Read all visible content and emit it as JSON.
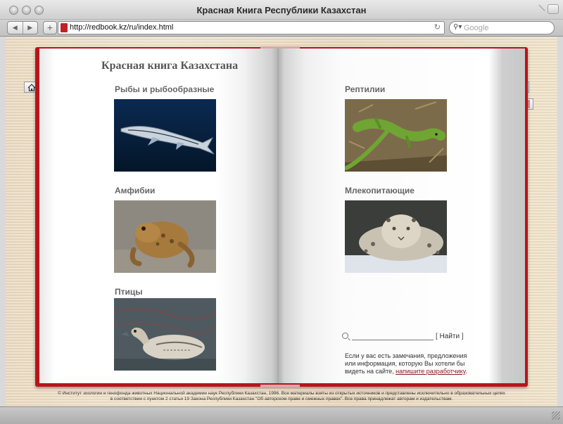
{
  "window": {
    "title": "Красная Книга Республики Казахстан"
  },
  "toolbar": {
    "back_label": "◀",
    "forward_label": "▶",
    "add_label": "+",
    "url": "http://redbook.kz/ru/index.html",
    "reload_label": "↻",
    "search_placeholder": "Google"
  },
  "book": {
    "title": "Красная книга Казахстана",
    "categories": [
      {
        "label": "Рыбы и рыбообразные"
      },
      {
        "label": "Амфибии"
      },
      {
        "label": "Птицы"
      },
      {
        "label": "Рептилии"
      },
      {
        "label": "Млекопитающие"
      }
    ],
    "search": {
      "button_label": "Найти"
    },
    "note": {
      "text": "Если у вас есть замечания, предложения или информация, которую Вы хотели бы видеть на сайте, ",
      "link": "напишите разработчику",
      "end": "."
    }
  },
  "colors": {
    "book_red": "#b9141c",
    "link": "#8e1a21"
  },
  "footer": {
    "line1": "© Институт зоологии и генофонда животных Национальной академии наук Республики Казахстан, 1996. Все материалы взяты из открытых источников и представлены исключительно в образовательных целях",
    "line2": "в соответствии с пунктом 2 статьи 19 Закона Республики Казахстан \"Об авторском праве и смежных правах\". Все права принадлежат авторам и издательствам."
  }
}
